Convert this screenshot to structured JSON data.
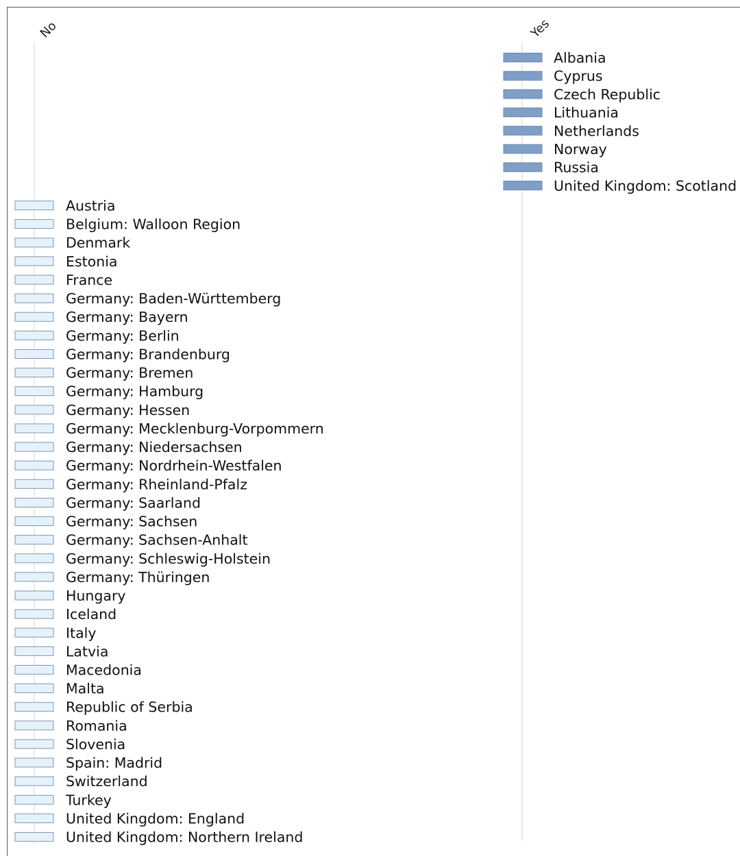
{
  "chart_data": {
    "type": "table",
    "columns": [
      {
        "name": "No",
        "color": "#e6f2fb",
        "stroke": "#7f95ab",
        "items": [
          "Austria",
          "Belgium: Walloon Region",
          "Denmark",
          "Estonia",
          "France",
          "Germany: Baden-Württemberg",
          "Germany: Bayern",
          "Germany: Berlin",
          "Germany: Brandenburg",
          "Germany: Bremen",
          "Germany: Hamburg",
          "Germany: Hessen",
          "Germany: Mecklenburg-Vorpommern",
          "Germany: Niedersachsen",
          "Germany: Nordrhein-Westfalen",
          "Germany: Rheinland-Pfalz",
          "Germany: Saarland",
          "Germany: Sachsen",
          "Germany: Sachsen-Anhalt",
          "Germany: Schleswig-Holstein",
          "Germany: Thüringen",
          "Hungary",
          "Iceland",
          "Italy",
          "Latvia",
          "Macedonia",
          "Malta",
          "Republic of Serbia",
          "Romania",
          "Slovenia",
          "Spain: Madrid",
          "Switzerland",
          "Turkey",
          "United Kingdom: England",
          "United Kingdom: Northern Ireland"
        ]
      },
      {
        "name": "Yes",
        "color": "#7f9fc6",
        "stroke": "#6a88b2",
        "items": [
          "Albania",
          "Cyprus",
          "Czech Republic",
          "Lithuania",
          "Netherlands",
          "Norway",
          "Russia",
          "United Kingdom: Scotland"
        ]
      }
    ]
  }
}
